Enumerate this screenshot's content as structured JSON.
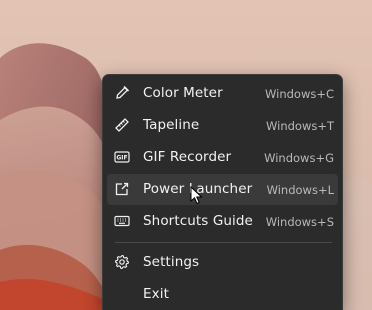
{
  "menu": {
    "items": [
      {
        "label": "Color Meter",
        "shortcut": "Windows+C",
        "icon": "eyedropper-icon"
      },
      {
        "label": "Tapeline",
        "shortcut": "Windows+T",
        "icon": "ruler-icon"
      },
      {
        "label": "GIF Recorder",
        "shortcut": "Windows+G",
        "icon": "gif-icon",
        "icon_text": "GIF"
      },
      {
        "label": "Power Launcher",
        "shortcut": "Windows+L",
        "icon": "launch-icon",
        "hovered": true
      },
      {
        "label": "Shortcuts Guide",
        "shortcut": "Windows+S",
        "icon": "keyboard-icon"
      }
    ],
    "settings_label": "Settings",
    "exit_label": "Exit"
  },
  "colors": {
    "menu_background": "#2b2b2b",
    "hover_background": "#3a3a3a",
    "text": "#f2f2f2",
    "shortcut_text": "#b9b9b9"
  }
}
